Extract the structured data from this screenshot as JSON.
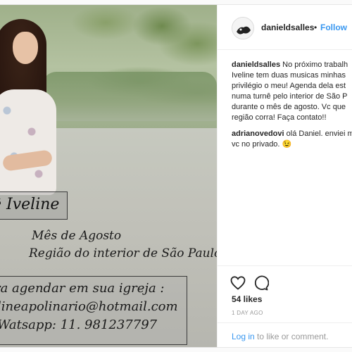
{
  "photo": {
    "name_text": "ê Iveline",
    "month_text": "Mês de Agosto",
    "region_text": "Região do interior de São Paulo",
    "booking_line1": "ra agendar em sua igreja :",
    "booking_line2": "lineapolinario@hotmail.com",
    "booking_line3": "Watsapp: 11. 981237797"
  },
  "header": {
    "username": "danieldsalles",
    "separator": "•",
    "follow_label": "Follow"
  },
  "comments": [
    {
      "user": "danieldsalles",
      "lines": [
        "No próximo trabalh",
        "Iveline tem duas musicas minhas",
        "privilégio o meu! Agenda dela est",
        "numa turnê pelo interior de São P",
        "durante o mês de agosto. Vc que",
        "região corra! Faça contato!!"
      ]
    },
    {
      "user": "adrianovedovi",
      "lines": [
        "olá Daniel. enviei m",
        "vc no privado. 😉"
      ]
    }
  ],
  "actions": {
    "likes_text": "54 likes",
    "time_text": "1 DAY AGO",
    "login_label": "Log in",
    "login_suffix": "to like or comment."
  },
  "colors": {
    "accent": "#3897f0",
    "text": "#262626",
    "muted": "#999999"
  },
  "icons": [
    "heart-icon",
    "comment-icon",
    "avatar"
  ]
}
